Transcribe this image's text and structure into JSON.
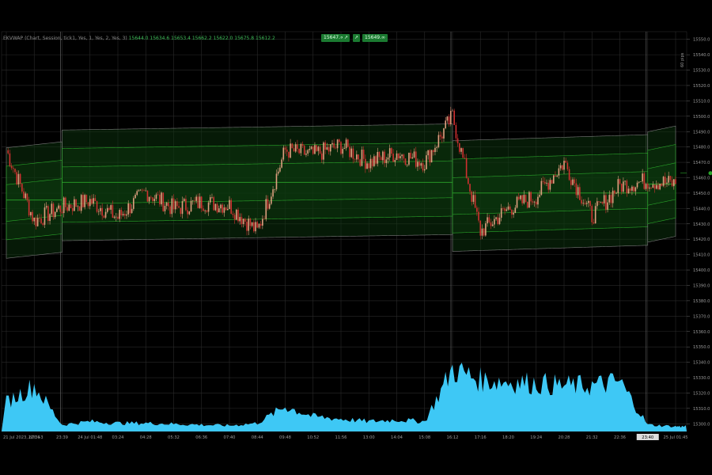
{
  "indicator": {
    "name": "EKVWAP (Chart, Session, tick1, Yes, 1, Yes, 2, Yes, 3)",
    "values": "15644.0 15634.6 15653.4 15662.2 15622.0 15675.8 15612.2"
  },
  "buttons": {
    "sell_price": "15647.∞",
    "sell_icon": "arrow-up-right-icon",
    "buy_icon": "arrow-up-right-icon",
    "buy_price": "15649.∞"
  },
  "pct_label": "60 pips",
  "colors": {
    "background": "#000000",
    "grid": "#2a2a2a",
    "up_candle": "#e0a080",
    "down_candle": "#d03030",
    "vwap_line": "#2aa42a",
    "band_fill": "#0e3a10",
    "band_outline": "#7a7a7a",
    "volume": "#3ec8f5",
    "session_separator": "#555555"
  },
  "chart_data": {
    "type": "line",
    "title": "",
    "xlabel": "",
    "ylabel": "",
    "ylim": [
      15295,
      15555
    ],
    "y_ticks": [
      "15550.0",
      "15540.0",
      "15530.0",
      "15520.0",
      "15510.0",
      "15500.0",
      "15490.0",
      "15480.0",
      "15470.0",
      "15460.0",
      "15450.0",
      "15440.0",
      "15430.0",
      "15420.0",
      "15410.0",
      "15400.0",
      "15390.0",
      "15380.0",
      "15370.0",
      "15360.0",
      "15350.0",
      "15340.0",
      "15330.0",
      "15320.0",
      "15310.0",
      "15300.0"
    ],
    "x_ticks": [
      "21 Jul 2023, UTC+3",
      "22:36",
      "23:39",
      "24 Jul 01:48",
      "03:24",
      "04:28",
      "05:32",
      "06:36",
      "07:40",
      "08:44",
      "09:48",
      "10:52",
      "11:56",
      "13:00",
      "14:04",
      "15:08",
      "16:12",
      "17:16",
      "18:20",
      "19:24",
      "20:28",
      "21:32",
      "22:36",
      "23:40",
      "25 Jul 01:45"
    ],
    "highlighted_x_tick": "23:40",
    "current_price_marker": 15463,
    "price": [
      {
        "x": "21 Jul 2023, UTC+3",
        "y": 15478
      },
      {
        "x": "22:36",
        "y": 15432
      },
      {
        "x": "23:39",
        "y": 15441
      },
      {
        "x": "24 Jul 01:48",
        "y": 15445
      },
      {
        "x": "03:24",
        "y": 15434
      },
      {
        "x": "04:28",
        "y": 15451
      },
      {
        "x": "05:32",
        "y": 15440
      },
      {
        "x": "06:36",
        "y": 15444
      },
      {
        "x": "07:40",
        "y": 15442
      },
      {
        "x": "08:44",
        "y": 15425
      },
      {
        "x": "09:48",
        "y": 15478
      },
      {
        "x": "10:52",
        "y": 15475
      },
      {
        "x": "11:56",
        "y": 15481
      },
      {
        "x": "13:00",
        "y": 15470
      },
      {
        "x": "14:04",
        "y": 15476
      },
      {
        "x": "15:08",
        "y": 15470
      },
      {
        "x": "16:12",
        "y": 15500
      },
      {
        "x": "17:16",
        "y": 15425
      },
      {
        "x": "18:20",
        "y": 15440
      },
      {
        "x": "19:24",
        "y": 15448
      },
      {
        "x": "20:28",
        "y": 15470
      },
      {
        "x": "21:32",
        "y": 15435
      },
      {
        "x": "22:36",
        "y": 15455
      },
      {
        "x": "23:40",
        "y": 15458
      },
      {
        "x": "25 Jul 01:45",
        "y": 15456
      }
    ],
    "volume_profile": [
      {
        "x": "21 Jul 2023, UTC+3",
        "y": 0.35
      },
      {
        "x": "22:36",
        "y": 0.55
      },
      {
        "x": "23:39",
        "y": 0.08
      },
      {
        "x": "24 Jul 01:48",
        "y": 0.12
      },
      {
        "x": "03:24",
        "y": 0.1
      },
      {
        "x": "04:28",
        "y": 0.1
      },
      {
        "x": "05:32",
        "y": 0.09
      },
      {
        "x": "06:36",
        "y": 0.08
      },
      {
        "x": "07:40",
        "y": 0.07
      },
      {
        "x": "08:44",
        "y": 0.1
      },
      {
        "x": "09:48",
        "y": 0.3
      },
      {
        "x": "10:52",
        "y": 0.18
      },
      {
        "x": "11:56",
        "y": 0.15
      },
      {
        "x": "13:00",
        "y": 0.12
      },
      {
        "x": "14:04",
        "y": 0.14
      },
      {
        "x": "15:08",
        "y": 0.12
      },
      {
        "x": "16:12",
        "y": 0.75
      },
      {
        "x": "17:16",
        "y": 0.62
      },
      {
        "x": "18:20",
        "y": 0.6
      },
      {
        "x": "19:24",
        "y": 0.58
      },
      {
        "x": "20:28",
        "y": 0.55
      },
      {
        "x": "21:32",
        "y": 0.55
      },
      {
        "x": "22:36",
        "y": 0.6
      },
      {
        "x": "23:40",
        "y": 0.08
      },
      {
        "x": "25 Jul 01:45",
        "y": 0.06
      }
    ]
  }
}
